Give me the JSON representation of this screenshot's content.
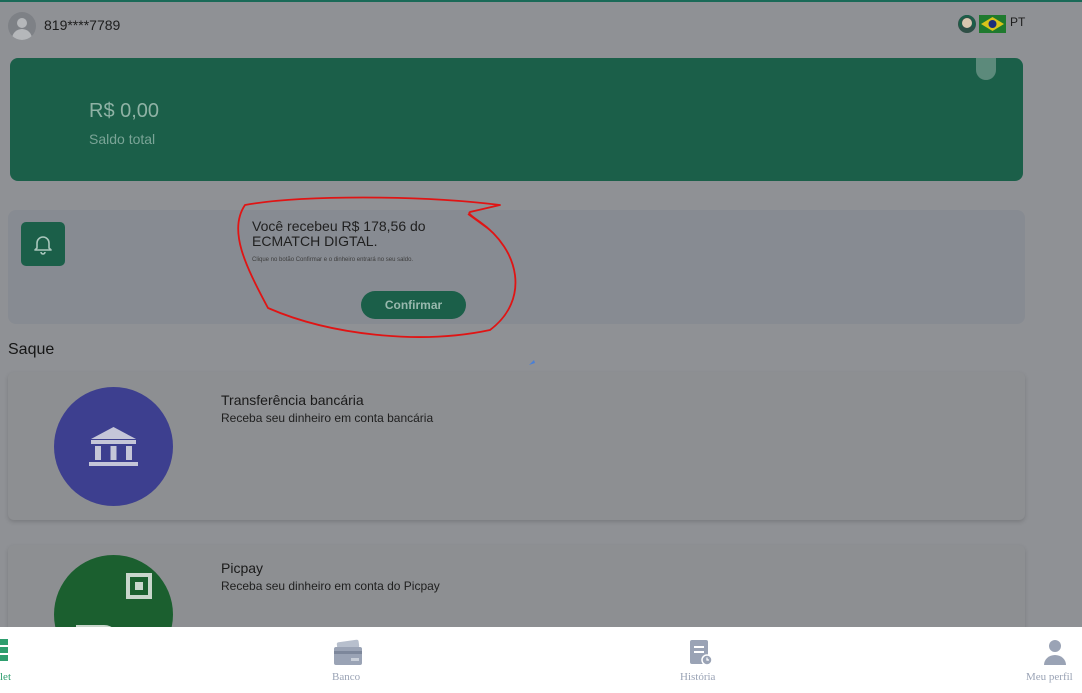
{
  "header": {
    "phone": "819****7789",
    "language": "PT"
  },
  "balance": {
    "amount": "R$ 0,00",
    "label": "Saldo total"
  },
  "notification": {
    "title": "Você recebeu R$ 178,56 do ECMATCH DIGTAL.",
    "subtitle": "Clique no botão Confirmar e o dinheiro entrará no seu saldo.",
    "confirm_label": "Confirmar"
  },
  "withdraw": {
    "title": "Saque",
    "methods": [
      {
        "name": "Transferência bancária",
        "description": "Receba seu dinheiro em conta bancária",
        "icon": "bank-icon"
      },
      {
        "name": "Picpay",
        "description": "Receba seu dinheiro em conta do Picpay",
        "icon": "picpay-icon"
      }
    ]
  },
  "nav": {
    "items": [
      {
        "label": "let",
        "icon": "wallet-icon",
        "active": true
      },
      {
        "label": "Banco",
        "icon": "card-icon",
        "active": false
      },
      {
        "label": "História",
        "icon": "history-icon",
        "active": false
      },
      {
        "label": "Meu perfil",
        "icon": "profile-icon",
        "active": false
      }
    ]
  },
  "colors": {
    "brand_green": "#1b5f49",
    "annotation_red": "#e01414",
    "nav_active": "#2e9e6e",
    "nav_inactive": "#9aa3b5"
  }
}
